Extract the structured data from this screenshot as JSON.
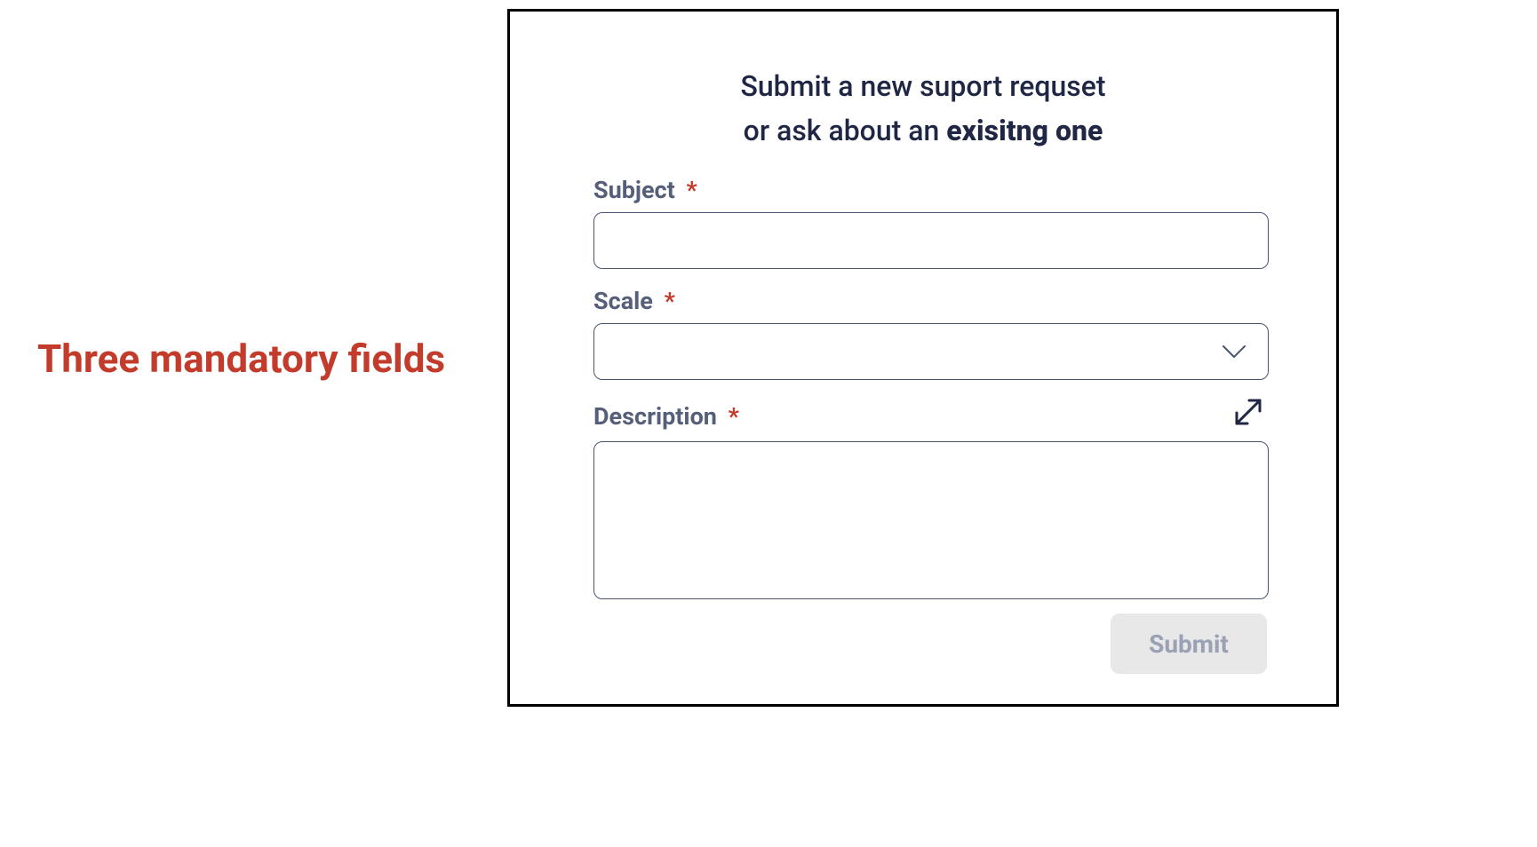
{
  "annotation": {
    "label": "Three mandatory fields"
  },
  "colors": {
    "annotation_red": "#c23b2b",
    "text_dark": "#1f2744",
    "label_color": "#565f7a",
    "border_color": "#4b5472",
    "submit_bg": "#e8e8e8",
    "submit_text": "#9aa1b5"
  },
  "form": {
    "heading_line1": "Submit a new suport requset",
    "heading_line2_prefix": "or ask about an ",
    "heading_line2_bold": "exisitng one",
    "required_marker": "*",
    "fields": {
      "subject": {
        "label": "Subject",
        "value": "",
        "placeholder": ""
      },
      "scale": {
        "label": "Scale",
        "selected": "",
        "placeholder": ""
      },
      "description": {
        "label": "Description",
        "value": "",
        "placeholder": ""
      }
    },
    "submit_label": "Submit"
  },
  "icons": {
    "chevron_down": "chevron-down-icon",
    "expand": "expand-icon"
  }
}
